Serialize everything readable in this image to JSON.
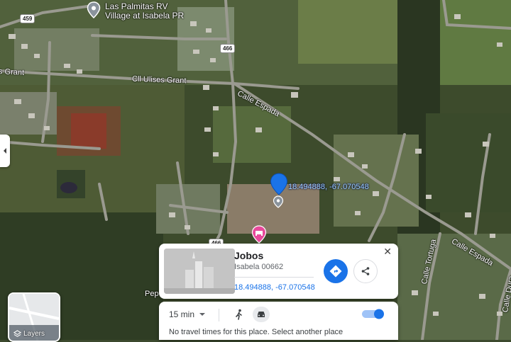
{
  "map": {
    "roads": {
      "route_459": "459",
      "route_466_top": "466",
      "route_466_bottom": "466",
      "grant_left": "s Grant",
      "ulises_grant": "Cll Ulises Grant",
      "calle_espada_top": "Calle Espada",
      "calle_espada_bottom": "Calle Espada",
      "calle_tortuga": "Calle Tortuga",
      "calle_duran": "Calle Dura",
      "pep_partial": "Pep"
    },
    "poi": {
      "name_line1": "Las Palmitas RV",
      "name_line2": "Village at Isabela PR"
    },
    "pin_coordinates": "18.494888, -67.070548"
  },
  "place_card": {
    "title": "Jobos",
    "address": "Isabela 00662",
    "coordinates": "18.494888, -67.070548",
    "close_symbol": "✕"
  },
  "travel": {
    "time": "15 min",
    "message": "No travel times for this place. Select another place"
  },
  "layers": {
    "label": "Layers"
  },
  "colors": {
    "accent": "#1a73e8",
    "pin": "#1a73e8",
    "hotel_pin": "#e8499b"
  }
}
